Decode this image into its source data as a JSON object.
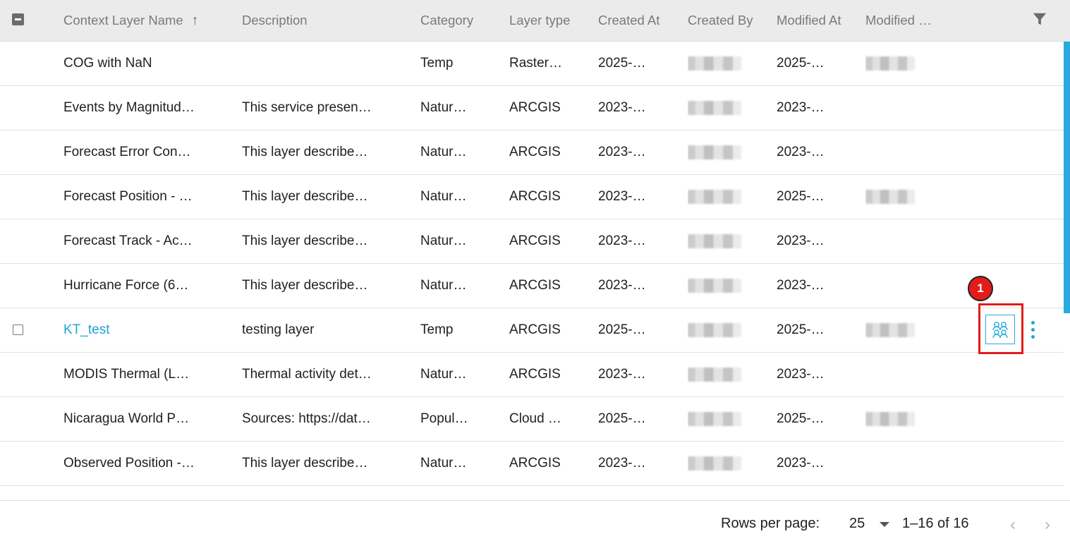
{
  "header": {
    "columns": [
      "Context Layer Name",
      "Description",
      "Category",
      "Layer type",
      "Created At",
      "Created By",
      "Modified At",
      "Modified …"
    ],
    "sort_icon": "arrow-up-icon",
    "filter_icon": "filter-icon"
  },
  "rows": [
    {
      "name": "COG with NaN",
      "description": "",
      "category": "Temp",
      "layer_type": "Raster…",
      "created_at": "2025-…",
      "created_by_blurred": true,
      "modified_at": "2025-…",
      "modified_by_blurred": true
    },
    {
      "name": "Events by Magnitud…",
      "description": "This service presen…",
      "category": "Natur…",
      "layer_type": "ARCGIS",
      "created_at": "2023-…",
      "created_by_blurred": true,
      "modified_at": "2023-…",
      "modified_by_blurred": false
    },
    {
      "name": "Forecast Error Con…",
      "description": "This layer describe…",
      "category": "Natur…",
      "layer_type": "ARCGIS",
      "created_at": "2023-…",
      "created_by_blurred": true,
      "modified_at": "2023-…",
      "modified_by_blurred": false
    },
    {
      "name": "Forecast Position - …",
      "description": "This layer describe…",
      "category": "Natur…",
      "layer_type": "ARCGIS",
      "created_at": "2023-…",
      "created_by_blurred": true,
      "modified_at": "2025-…",
      "modified_by_blurred": true
    },
    {
      "name": "Forecast Track - Ac…",
      "description": "This layer describe…",
      "category": "Natur…",
      "layer_type": "ARCGIS",
      "created_at": "2023-…",
      "created_by_blurred": true,
      "modified_at": "2023-…",
      "modified_by_blurred": false
    },
    {
      "name": "Hurricane Force (6…",
      "description": "This layer describe…",
      "category": "Natur…",
      "layer_type": "ARCGIS",
      "created_at": "2023-…",
      "created_by_blurred": true,
      "modified_at": "2023-…",
      "modified_by_blurred": false
    },
    {
      "name": "KT_test",
      "description": "testing layer",
      "category": "Temp",
      "layer_type": "ARCGIS",
      "created_at": "2025-…",
      "created_by_blurred": true,
      "modified_at": "2025-…",
      "modified_by_blurred": true
    },
    {
      "name": "MODIS Thermal (L…",
      "description": "Thermal activity det…",
      "category": "Natur…",
      "layer_type": "ARCGIS",
      "created_at": "2023-…",
      "created_by_blurred": true,
      "modified_at": "2023-…",
      "modified_by_blurred": false
    },
    {
      "name": "Nicaragua World P…",
      "description": "Sources: https://dat…",
      "category": "Popul…",
      "layer_type": "Cloud …",
      "created_at": "2025-…",
      "created_by_blurred": true,
      "modified_at": "2025-…",
      "modified_by_blurred": true
    },
    {
      "name": "Observed Position -…",
      "description": "This layer describe…",
      "category": "Natur…",
      "layer_type": "ARCGIS",
      "created_at": "2023-…",
      "created_by_blurred": true,
      "modified_at": "2023-…",
      "modified_by_blurred": false
    }
  ],
  "hovered_row_actions": {
    "share_icon": "users-group-icon",
    "more_icon": "more-vertical-icon",
    "annotation_number": "1"
  },
  "footer": {
    "rows_per_page_label": "Rows per page:",
    "rows_per_page_value": "25",
    "range_text": "1–16 of 16"
  },
  "colors": {
    "accent": "#1ea5d6",
    "header_bg": "#ebebeb",
    "highlight": "#e31b1b"
  }
}
